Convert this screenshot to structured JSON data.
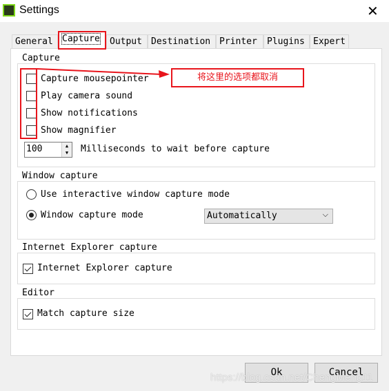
{
  "window": {
    "title": "Settings",
    "close_icon": "close-icon"
  },
  "tabs": [
    {
      "label": "General"
    },
    {
      "label": "Capture",
      "active": true
    },
    {
      "label": "Output"
    },
    {
      "label": "Destination"
    },
    {
      "label": "Printer"
    },
    {
      "label": "Plugins"
    },
    {
      "label": "Expert"
    }
  ],
  "capture_group": {
    "title": "Capture",
    "options": [
      {
        "label": "Capture mousepointer",
        "checked": false
      },
      {
        "label": "Play camera sound",
        "checked": false
      },
      {
        "label": "Show notifications",
        "checked": false
      },
      {
        "label": "Show magnifier",
        "checked": false
      }
    ],
    "wait_value": "100",
    "wait_label": "Milliseconds to wait before capture"
  },
  "window_group": {
    "title": "Window capture",
    "radio_interactive": "Use interactive window capture mode",
    "radio_mode": "Window capture mode",
    "selected": "Window capture mode",
    "mode_value": "Automatically"
  },
  "ie_group": {
    "title": "Internet Explorer capture",
    "option": "Internet Explorer capture",
    "checked": true
  },
  "editor_group": {
    "title": "Editor",
    "option": "Match capture size",
    "checked": true
  },
  "buttons": {
    "ok": "Ok",
    "cancel": "Cancel"
  },
  "annotation": {
    "text": "将这里的选项都取消",
    "color": "#e8141b"
  },
  "watermark": "https://blog.csdn.net/ChengMeng11"
}
